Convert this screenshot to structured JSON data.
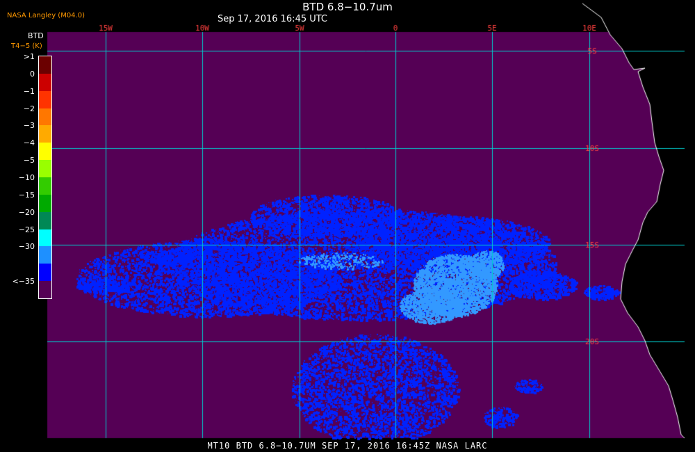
{
  "header": {
    "title": "BTD 6.8−10.7um",
    "date": "Sep 17, 2016 16:45 UTC",
    "agency": "NASA Langley (M04.0)"
  },
  "legend": {
    "title": "BTD",
    "subtitle": "T4−5 (K)",
    "levels": [
      {
        "label": ">1",
        "color": "#6b0000"
      },
      {
        "label": "0",
        "color": "#cc0000"
      },
      {
        "label": "−1",
        "color": "#ff3300"
      },
      {
        "label": "−2",
        "color": "#ff7700"
      },
      {
        "label": "−3",
        "color": "#ffaa00"
      },
      {
        "label": "−4",
        "color": "#ffff00"
      },
      {
        "label": "−5",
        "color": "#99ff00"
      },
      {
        "label": "−10",
        "color": "#33cc00"
      },
      {
        "label": "−15",
        "color": "#00aa00"
      },
      {
        "label": "−20",
        "color": "#008855"
      },
      {
        "label": "−25",
        "color": "#00ffff"
      },
      {
        "label": "−30",
        "color": "#1e90ff"
      },
      {
        "label": "<−35",
        "color": "#0000ff"
      },
      {
        "label": "",
        "color": "#550055"
      }
    ]
  },
  "map": {
    "background_color": "#550055",
    "grid_color": "#00cccc",
    "label_color": "#ff4040",
    "coast_color": "#ffffff",
    "longitude_labels": [
      "15W",
      "10W",
      "5W",
      "0",
      "5E",
      "10E"
    ],
    "latitude_labels": [
      "5S",
      "10S",
      "15S",
      "20S"
    ]
  },
  "footer": {
    "text": "MT10  BTD 6.8−10.7UM   SEP 17, 2016 16:45Z   NASA LARC"
  }
}
